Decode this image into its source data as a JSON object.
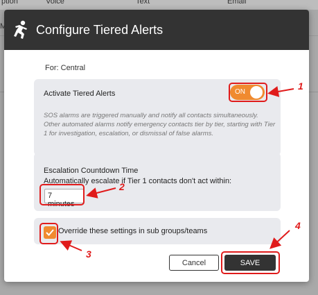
{
  "background": {
    "columns": [
      "ption",
      "Voice",
      "Text",
      "Email"
    ],
    "row_text": "M"
  },
  "modal": {
    "title": "Configure Tiered Alerts",
    "for_label": "For:",
    "for_value": "Central"
  },
  "tiered": {
    "title": "Activate Tiered Alerts",
    "toggle_label": "ON",
    "toggle_on": true,
    "description": "SOS alarms are triggered manually and notify all contacts simultaneously. Other automated alarms notify emergency contacts tier by tier, starting with Tier 1 for investigation, escalation, or dismissal of false alarms."
  },
  "escalation": {
    "title": "Escalation Countdown Time",
    "description": "Automatically escalate if Tier 1 contacts don't act within:",
    "value": "7 minutes"
  },
  "override": {
    "label": "Override these settings in sub groups/teams",
    "checked": true
  },
  "buttons": {
    "cancel": "Cancel",
    "save": "SAVE"
  },
  "annotations": {
    "n1": "1",
    "n2": "2",
    "n3": "3",
    "n4": "4",
    "color": "#e01b1b"
  },
  "colors": {
    "accent": "#f08a2f",
    "header": "#333333",
    "panel": "#e9eaee"
  }
}
